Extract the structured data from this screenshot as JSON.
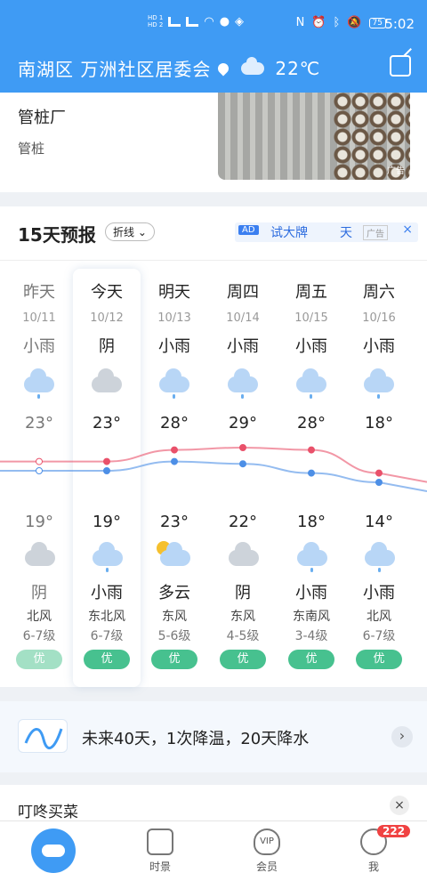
{
  "status_bar": {
    "time": "5:02",
    "battery": "75",
    "hd_top": "HD 1",
    "hd_bottom": "HD 2"
  },
  "header": {
    "location": "南湖区 万洲社区居委会",
    "temp": "22℃",
    "share_icon": "share-icon"
  },
  "ad_card": {
    "title": "管桩厂",
    "subtitle": "管桩",
    "tag": "广告"
  },
  "forecast": {
    "title": "15天预报",
    "mode_label": "折线",
    "ad": {
      "badge": "AD",
      "text": "试大牌",
      "text2": "天",
      "tag": "广告",
      "close": "×"
    },
    "days": [
      {
        "day": "昨天",
        "date": "10/11",
        "wx_day": "小雨",
        "hi": "23°",
        "lo": "19°",
        "wx_night": "阴",
        "wind": "北风",
        "level": "6-7级",
        "aqi": "优",
        "past": true
      },
      {
        "day": "今天",
        "date": "10/12",
        "wx_day": "阴",
        "hi": "23°",
        "lo": "19°",
        "wx_night": "小雨",
        "wind": "东北风",
        "level": "6-7级",
        "aqi": "优",
        "past": false
      },
      {
        "day": "明天",
        "date": "10/13",
        "wx_day": "小雨",
        "hi": "28°",
        "lo": "23°",
        "wx_night": "多云",
        "wind": "东风",
        "level": "5-6级",
        "aqi": "优",
        "past": false
      },
      {
        "day": "周四",
        "date": "10/14",
        "wx_day": "小雨",
        "hi": "29°",
        "lo": "22°",
        "wx_night": "阴",
        "wind": "东风",
        "level": "4-5级",
        "aqi": "优",
        "past": false
      },
      {
        "day": "周五",
        "date": "10/15",
        "wx_day": "小雨",
        "hi": "28°",
        "lo": "18°",
        "wx_night": "小雨",
        "wind": "东南风",
        "level": "3-4级",
        "aqi": "优",
        "past": false
      },
      {
        "day": "周六",
        "date": "10/16",
        "wx_day": "小雨",
        "hi": "18°",
        "lo": "14°",
        "wx_night": "小雨",
        "wind": "北风",
        "level": "6-7级",
        "aqi": "优",
        "past": false
      }
    ]
  },
  "forty_day": {
    "text": "未来40天，1次降温，20天降水"
  },
  "shop": {
    "title": "叮咚买菜",
    "close": "×"
  },
  "tabbar": {
    "items": [
      {
        "label": ""
      },
      {
        "label": "时景"
      },
      {
        "label": "会员"
      },
      {
        "label": "我"
      }
    ],
    "vip_icon_text": "VIP",
    "badge": "222"
  },
  "colors": {
    "brand": "#3f9bf4",
    "high_curve": "#e9516a",
    "low_curve": "#4d8fe6",
    "aqi_good": "#47c18f"
  }
}
